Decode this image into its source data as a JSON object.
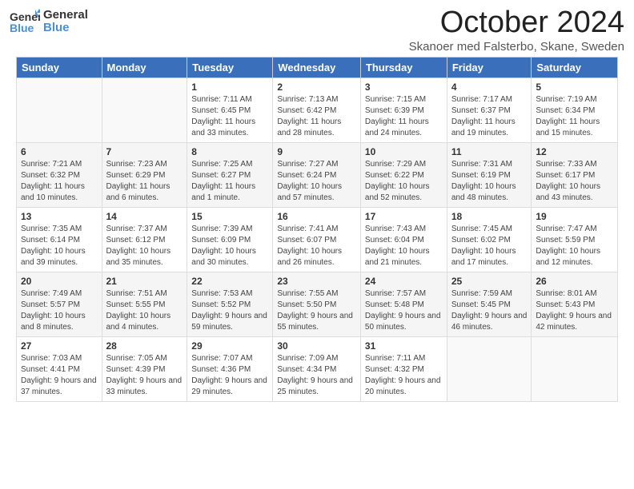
{
  "header": {
    "logo": {
      "general": "General",
      "blue": "Blue"
    },
    "title": "October 2024",
    "subtitle": "Skanoer med Falsterbo, Skane, Sweden"
  },
  "weekdays": [
    "Sunday",
    "Monday",
    "Tuesday",
    "Wednesday",
    "Thursday",
    "Friday",
    "Saturday"
  ],
  "weeks": [
    [
      {
        "day": "",
        "sunrise": "",
        "sunset": "",
        "daylight": ""
      },
      {
        "day": "",
        "sunrise": "",
        "sunset": "",
        "daylight": ""
      },
      {
        "day": "1",
        "sunrise": "Sunrise: 7:11 AM",
        "sunset": "Sunset: 6:45 PM",
        "daylight": "Daylight: 11 hours and 33 minutes."
      },
      {
        "day": "2",
        "sunrise": "Sunrise: 7:13 AM",
        "sunset": "Sunset: 6:42 PM",
        "daylight": "Daylight: 11 hours and 28 minutes."
      },
      {
        "day": "3",
        "sunrise": "Sunrise: 7:15 AM",
        "sunset": "Sunset: 6:39 PM",
        "daylight": "Daylight: 11 hours and 24 minutes."
      },
      {
        "day": "4",
        "sunrise": "Sunrise: 7:17 AM",
        "sunset": "Sunset: 6:37 PM",
        "daylight": "Daylight: 11 hours and 19 minutes."
      },
      {
        "day": "5",
        "sunrise": "Sunrise: 7:19 AM",
        "sunset": "Sunset: 6:34 PM",
        "daylight": "Daylight: 11 hours and 15 minutes."
      }
    ],
    [
      {
        "day": "6",
        "sunrise": "Sunrise: 7:21 AM",
        "sunset": "Sunset: 6:32 PM",
        "daylight": "Daylight: 11 hours and 10 minutes."
      },
      {
        "day": "7",
        "sunrise": "Sunrise: 7:23 AM",
        "sunset": "Sunset: 6:29 PM",
        "daylight": "Daylight: 11 hours and 6 minutes."
      },
      {
        "day": "8",
        "sunrise": "Sunrise: 7:25 AM",
        "sunset": "Sunset: 6:27 PM",
        "daylight": "Daylight: 11 hours and 1 minute."
      },
      {
        "day": "9",
        "sunrise": "Sunrise: 7:27 AM",
        "sunset": "Sunset: 6:24 PM",
        "daylight": "Daylight: 10 hours and 57 minutes."
      },
      {
        "day": "10",
        "sunrise": "Sunrise: 7:29 AM",
        "sunset": "Sunset: 6:22 PM",
        "daylight": "Daylight: 10 hours and 52 minutes."
      },
      {
        "day": "11",
        "sunrise": "Sunrise: 7:31 AM",
        "sunset": "Sunset: 6:19 PM",
        "daylight": "Daylight: 10 hours and 48 minutes."
      },
      {
        "day": "12",
        "sunrise": "Sunrise: 7:33 AM",
        "sunset": "Sunset: 6:17 PM",
        "daylight": "Daylight: 10 hours and 43 minutes."
      }
    ],
    [
      {
        "day": "13",
        "sunrise": "Sunrise: 7:35 AM",
        "sunset": "Sunset: 6:14 PM",
        "daylight": "Daylight: 10 hours and 39 minutes."
      },
      {
        "day": "14",
        "sunrise": "Sunrise: 7:37 AM",
        "sunset": "Sunset: 6:12 PM",
        "daylight": "Daylight: 10 hours and 35 minutes."
      },
      {
        "day": "15",
        "sunrise": "Sunrise: 7:39 AM",
        "sunset": "Sunset: 6:09 PM",
        "daylight": "Daylight: 10 hours and 30 minutes."
      },
      {
        "day": "16",
        "sunrise": "Sunrise: 7:41 AM",
        "sunset": "Sunset: 6:07 PM",
        "daylight": "Daylight: 10 hours and 26 minutes."
      },
      {
        "day": "17",
        "sunrise": "Sunrise: 7:43 AM",
        "sunset": "Sunset: 6:04 PM",
        "daylight": "Daylight: 10 hours and 21 minutes."
      },
      {
        "day": "18",
        "sunrise": "Sunrise: 7:45 AM",
        "sunset": "Sunset: 6:02 PM",
        "daylight": "Daylight: 10 hours and 17 minutes."
      },
      {
        "day": "19",
        "sunrise": "Sunrise: 7:47 AM",
        "sunset": "Sunset: 5:59 PM",
        "daylight": "Daylight: 10 hours and 12 minutes."
      }
    ],
    [
      {
        "day": "20",
        "sunrise": "Sunrise: 7:49 AM",
        "sunset": "Sunset: 5:57 PM",
        "daylight": "Daylight: 10 hours and 8 minutes."
      },
      {
        "day": "21",
        "sunrise": "Sunrise: 7:51 AM",
        "sunset": "Sunset: 5:55 PM",
        "daylight": "Daylight: 10 hours and 4 minutes."
      },
      {
        "day": "22",
        "sunrise": "Sunrise: 7:53 AM",
        "sunset": "Sunset: 5:52 PM",
        "daylight": "Daylight: 9 hours and 59 minutes."
      },
      {
        "day": "23",
        "sunrise": "Sunrise: 7:55 AM",
        "sunset": "Sunset: 5:50 PM",
        "daylight": "Daylight: 9 hours and 55 minutes."
      },
      {
        "day": "24",
        "sunrise": "Sunrise: 7:57 AM",
        "sunset": "Sunset: 5:48 PM",
        "daylight": "Daylight: 9 hours and 50 minutes."
      },
      {
        "day": "25",
        "sunrise": "Sunrise: 7:59 AM",
        "sunset": "Sunset: 5:45 PM",
        "daylight": "Daylight: 9 hours and 46 minutes."
      },
      {
        "day": "26",
        "sunrise": "Sunrise: 8:01 AM",
        "sunset": "Sunset: 5:43 PM",
        "daylight": "Daylight: 9 hours and 42 minutes."
      }
    ],
    [
      {
        "day": "27",
        "sunrise": "Sunrise: 7:03 AM",
        "sunset": "Sunset: 4:41 PM",
        "daylight": "Daylight: 9 hours and 37 minutes."
      },
      {
        "day": "28",
        "sunrise": "Sunrise: 7:05 AM",
        "sunset": "Sunset: 4:39 PM",
        "daylight": "Daylight: 9 hours and 33 minutes."
      },
      {
        "day": "29",
        "sunrise": "Sunrise: 7:07 AM",
        "sunset": "Sunset: 4:36 PM",
        "daylight": "Daylight: 9 hours and 29 minutes."
      },
      {
        "day": "30",
        "sunrise": "Sunrise: 7:09 AM",
        "sunset": "Sunset: 4:34 PM",
        "daylight": "Daylight: 9 hours and 25 minutes."
      },
      {
        "day": "31",
        "sunrise": "Sunrise: 7:11 AM",
        "sunset": "Sunset: 4:32 PM",
        "daylight": "Daylight: 9 hours and 20 minutes."
      },
      {
        "day": "",
        "sunrise": "",
        "sunset": "",
        "daylight": ""
      },
      {
        "day": "",
        "sunrise": "",
        "sunset": "",
        "daylight": ""
      }
    ]
  ]
}
